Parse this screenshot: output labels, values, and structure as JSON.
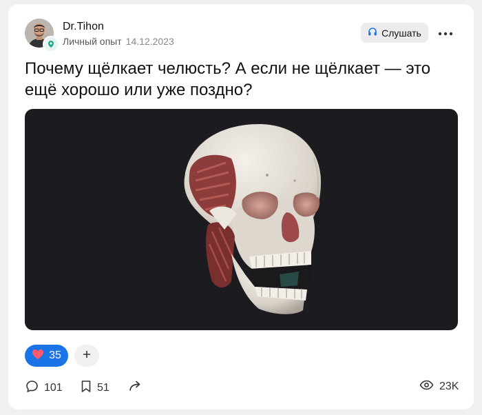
{
  "post": {
    "author": {
      "name": "Dr.Tihon",
      "category": "Личный опыт",
      "date": "14.12.2023"
    },
    "actions": {
      "listen_label": "Слушать",
      "listen_icon": "headphones-icon",
      "more_icon": "more-dots-icon"
    },
    "title": "Почему щёлкает челюсть? А если не щёлкает — это ещё хорошо или уже поздно?",
    "image": {
      "subject": "skull-illustration",
      "background": "#1c1b1f"
    },
    "reactions": {
      "like_count": "35",
      "like_icon": "heart-icon",
      "add_icon": "plus-icon",
      "accent": "#1a74e8"
    },
    "footer": {
      "comments": "101",
      "bookmarks": "51",
      "views": "23K"
    }
  }
}
